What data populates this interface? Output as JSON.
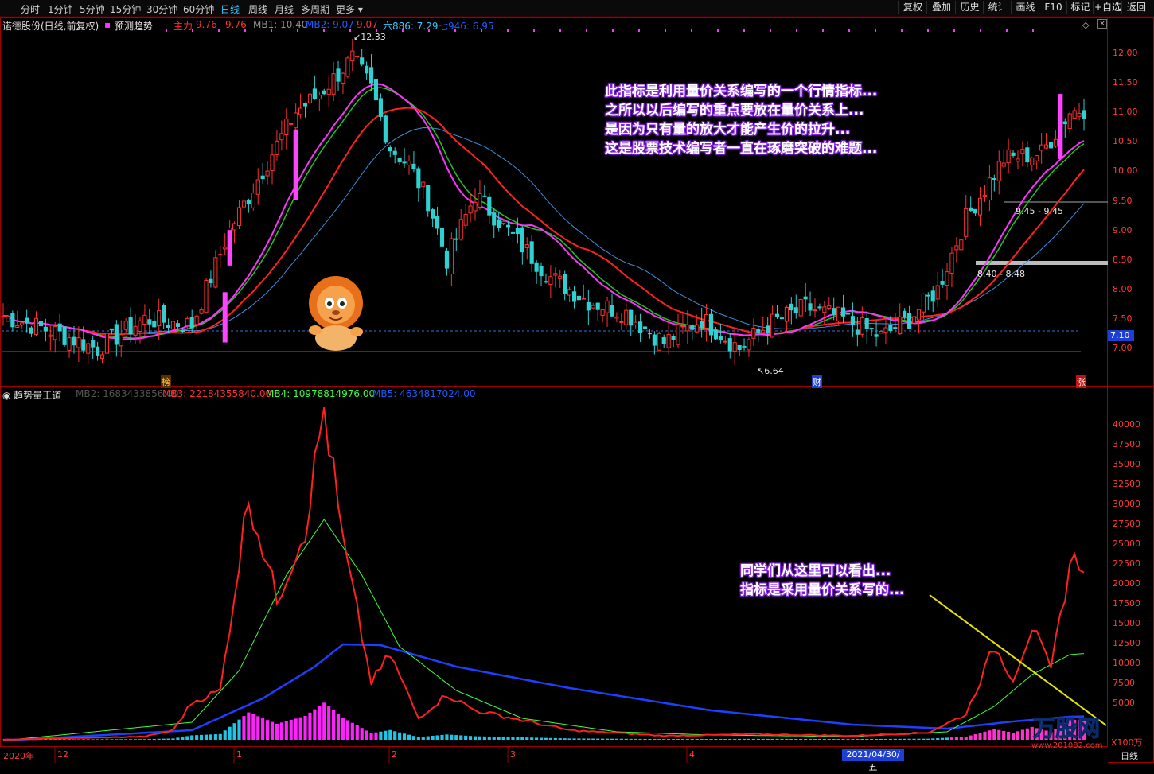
{
  "toolbar": {
    "periods": [
      "分时",
      "1分钟",
      "5分钟",
      "15分钟",
      "30分钟",
      "60分钟",
      "日线",
      "周线",
      "月线",
      "多周期",
      "更多"
    ],
    "active": "日线",
    "right_buttons": [
      "复权",
      "叠加",
      "历史",
      "统计",
      "画线",
      "F10",
      "标记",
      "+自选",
      "返回"
    ]
  },
  "main_panel": {
    "title": "诺德股份(日线,前复权)",
    "indicator_name": "预测趋势",
    "legend": [
      {
        "label": "主力",
        "text": "主力",
        "color": "#ff3030"
      },
      {
        "label": "value1",
        "text": "9.76",
        "color": "#ff3030"
      },
      {
        "label": "value2",
        "text": "9.76",
        "color": "#ff3030"
      },
      {
        "label": "MB1",
        "text": "MB1: 10.40",
        "color": "#909090"
      },
      {
        "label": "MB2",
        "text": "MB2: 9.07",
        "color": "#1e5cff"
      },
      {
        "label": "value3",
        "text": "9.07",
        "color": "#ff3030"
      },
      {
        "label": "L6",
        "text": "六886: 7.29",
        "color": "#33c7ff"
      },
      {
        "label": "L7",
        "text": "七946: 6.95",
        "color": "#1e5cff"
      }
    ],
    "y_ticks": [
      "12.00",
      "11.50",
      "11.00",
      "10.50",
      "10.00",
      "9.50",
      "9.00",
      "8.50",
      "8.00",
      "7.50",
      "7.00"
    ],
    "current_price_tag": "7.10",
    "high_mark": "12.33",
    "low_mark": "6.64",
    "range_labels": [
      "9.45 - 9.45",
      "8.40 - 8.48"
    ],
    "badges": [
      "榜",
      "财",
      "涨"
    ],
    "callout": [
      "此指标是利用量价关系编写的一个行情指标...",
      "之所以以后编写的重点要放在量价关系上...",
      "是因为只有量的放大才能产生价的拉升...",
      "这是股票技术编写者一直在琢磨突破的难题..."
    ]
  },
  "sub_panel": {
    "indicator_name": "趋势量王道",
    "legend": [
      {
        "label": "MB2",
        "text": "MB2: 1683433856.00",
        "color": "#555555"
      },
      {
        "label": "MB3",
        "text": "MB3: 22184355840.00",
        "color": "#ff3030"
      },
      {
        "label": "MB4",
        "text": "MB4: 10978814976.00",
        "color": "#3cff3c"
      },
      {
        "label": "MB5",
        "text": "MB5: 4634817024.00",
        "color": "#1e5cff"
      }
    ],
    "y_ticks": [
      "40000",
      "37500",
      "35000",
      "32500",
      "30000",
      "27500",
      "25000",
      "22500",
      "20000",
      "17500",
      "15000",
      "12500",
      "10000",
      "7500",
      "5000"
    ],
    "unit": "X100万",
    "callout": [
      "同学们从这里可以看出...",
      "指标是采用量价关系写的..."
    ],
    "x_labels": [
      "2020年",
      "12",
      "1",
      "2",
      "3",
      "4"
    ],
    "cursor_date": "2021/04/30/五",
    "bottom_right": "日线"
  },
  "colors": {
    "up": "#ff3030",
    "down": "#2ed1d1",
    "ma_magenta": "#ff33ff",
    "ma_red": "#ff2020",
    "ma_green": "#22c422",
    "ma_blue": "#3a8fe0",
    "accent": "#1e3fd4"
  },
  "chart_data": {
    "type": "candlestick",
    "price_key_points": [
      [
        0,
        7.55
      ],
      [
        10,
        7.3
      ],
      [
        20,
        7.0
      ],
      [
        30,
        7.5
      ],
      [
        40,
        7.4
      ],
      [
        48,
        9.0
      ],
      [
        57,
        10.3
      ],
      [
        62,
        11.0
      ],
      [
        67,
        11.3
      ],
      [
        74,
        11.9
      ],
      [
        78,
        11.4
      ],
      [
        82,
        10.4
      ],
      [
        86,
        10.1
      ],
      [
        90,
        9.5
      ],
      [
        94,
        8.5
      ],
      [
        100,
        9.6
      ],
      [
        108,
        8.9
      ],
      [
        116,
        8.2
      ],
      [
        124,
        7.8
      ],
      [
        132,
        7.6
      ],
      [
        140,
        7.1
      ],
      [
        148,
        7.5
      ],
      [
        156,
        7.0
      ],
      [
        162,
        7.4
      ],
      [
        170,
        7.7
      ],
      [
        178,
        7.5
      ],
      [
        186,
        7.2
      ],
      [
        192,
        7.5
      ],
      [
        198,
        8.0
      ],
      [
        204,
        9.2
      ],
      [
        212,
        10.2
      ],
      [
        220,
        10.3
      ],
      [
        226,
        11.0
      ]
    ],
    "bars": 230,
    "volume_red_key_points": [
      [
        0,
        300
      ],
      [
        30,
        700
      ],
      [
        36,
        1500
      ],
      [
        40,
        5000
      ],
      [
        46,
        6500
      ],
      [
        52,
        31000
      ],
      [
        58,
        18000
      ],
      [
        64,
        27000
      ],
      [
        68,
        42000
      ],
      [
        72,
        25000
      ],
      [
        78,
        7500
      ],
      [
        82,
        11000
      ],
      [
        88,
        3000
      ],
      [
        94,
        6000
      ],
      [
        100,
        4000
      ],
      [
        108,
        3000
      ],
      [
        120,
        1500
      ],
      [
        140,
        800
      ],
      [
        160,
        1000
      ],
      [
        180,
        800
      ],
      [
        196,
        1200
      ],
      [
        204,
        3500
      ],
      [
        210,
        12000
      ],
      [
        214,
        8000
      ],
      [
        218,
        14500
      ],
      [
        222,
        9000
      ],
      [
        226,
        22500
      ]
    ],
    "volume_green_key_points": [
      [
        0,
        200
      ],
      [
        40,
        2500
      ],
      [
        50,
        9000
      ],
      [
        60,
        21000
      ],
      [
        68,
        28000
      ],
      [
        76,
        21000
      ],
      [
        84,
        12000
      ],
      [
        96,
        6500
      ],
      [
        110,
        3000
      ],
      [
        130,
        1300
      ],
      [
        150,
        900
      ],
      [
        180,
        700
      ],
      [
        200,
        1300
      ],
      [
        210,
        4500
      ],
      [
        218,
        8500
      ],
      [
        226,
        11000
      ]
    ],
    "volume_blue_key_points": [
      [
        0,
        200
      ],
      [
        40,
        1500
      ],
      [
        55,
        5500
      ],
      [
        66,
        9500
      ],
      [
        72,
        12300
      ],
      [
        80,
        12200
      ],
      [
        96,
        9500
      ],
      [
        120,
        6800
      ],
      [
        150,
        4000
      ],
      [
        180,
        2200
      ],
      [
        200,
        1700
      ],
      [
        214,
        2600
      ],
      [
        226,
        3200
      ]
    ]
  }
}
